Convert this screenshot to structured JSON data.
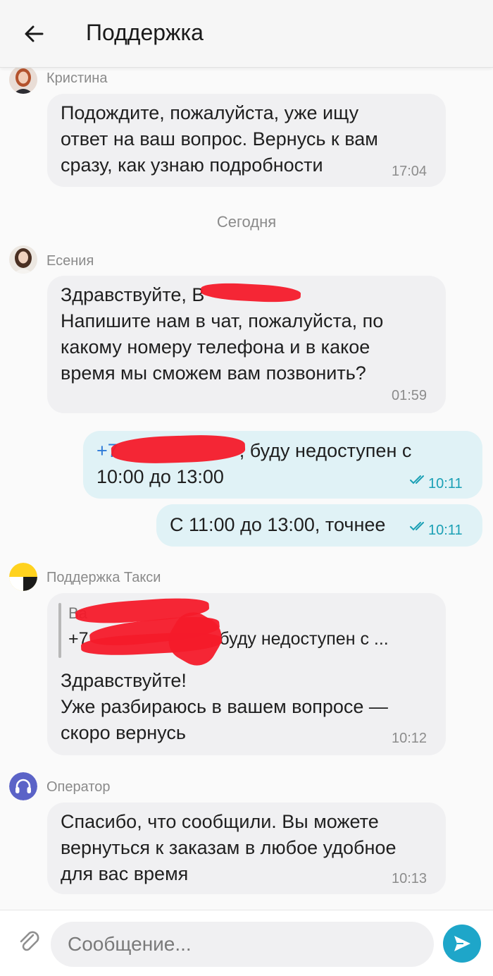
{
  "header": {
    "title": "Поддержка"
  },
  "messages": {
    "m1": {
      "sender": "Кристина",
      "lines": [
        "Подождите, пожалуйста, уже ищу",
        "ответ на ваш вопрос. Вернусь к вам",
        "сразу, как узнаю подробности"
      ],
      "time": "17:04"
    },
    "date_separator": "Сегодня",
    "m2": {
      "sender": "Есения",
      "lines": [
        "Здравствуйте, В",
        "Напишите нам в чат, пожалуйста, по",
        "какому номеру телефона и в какое",
        "время мы сможем вам позвонить?"
      ],
      "time": "01:59"
    },
    "m3": {
      "phone": "+7",
      "line1_rest": ", буду недоступен  с",
      "line2": "10:00 до 13:00",
      "time": "10:11",
      "status": "double-check-icon"
    },
    "m4": {
      "text": "С 11:00 до 13:00, точнее",
      "time": "10:11",
      "status": "double-check-icon"
    },
    "m5": {
      "sender": "Поддержка Такси",
      "quote_line1": "Ва",
      "quote_line2_start": "+7",
      "quote_line2_end": ", буду недоступен  с ...",
      "lines": [
        "Здравствуйте!",
        "Уже разбираюсь в вашем вопросе —",
        "скоро вернусь"
      ],
      "time": "10:12"
    },
    "m6": {
      "sender": "Оператор",
      "lines": [
        "Спасибо, что сообщили. Вы можете",
        "вернуться к заказам в любое удобное",
        "для вас время"
      ],
      "time": "10:13"
    }
  },
  "composer": {
    "placeholder": "Сообщение..."
  },
  "colors": {
    "accent": "#1ea6c9",
    "outgoing_bubble": "#e0f2f6",
    "incoming_bubble": "#f0f0f2",
    "redaction": "#f41a2a",
    "brand_yellow": "#ffd21e",
    "operator_avatar": "#5b63c7"
  }
}
